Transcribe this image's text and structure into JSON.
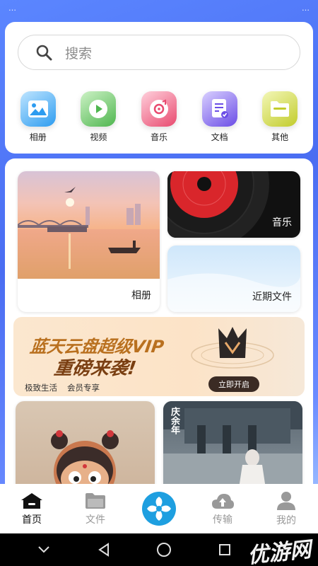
{
  "status": {
    "left": "…",
    "right": "…"
  },
  "search": {
    "placeholder": "搜索"
  },
  "categories": [
    {
      "label": "相册",
      "icon": "photo-icon",
      "color": "#36a8f4"
    },
    {
      "label": "视频",
      "icon": "play-icon",
      "color": "#58c15b"
    },
    {
      "label": "音乐",
      "icon": "music-disc-icon",
      "color": "#ef5a7c"
    },
    {
      "label": "文档",
      "icon": "document-icon",
      "color": "#7a5cf0"
    },
    {
      "label": "其他",
      "icon": "folder-icon",
      "color": "#c8d23a"
    }
  ],
  "tiles": {
    "album": "相册",
    "music": "音乐",
    "recent": "近期文件"
  },
  "vip": {
    "title": "蓝天云盘超级VIP",
    "subtitle": "重磅来袭!",
    "tag1": "极致生活",
    "tag2": "会员专享",
    "button": "立即开启"
  },
  "drama": {
    "caption": "庆余年"
  },
  "nav": [
    {
      "label": "首页",
      "icon": "home-icon",
      "active": true
    },
    {
      "label": "文件",
      "icon": "folder-icon",
      "active": false
    },
    {
      "label": "",
      "icon": "app-logo-icon",
      "active": false
    },
    {
      "label": "传输",
      "icon": "cloud-upload-icon",
      "active": false
    },
    {
      "label": "我的",
      "icon": "user-icon",
      "active": false
    }
  ],
  "watermark": "优游网",
  "colors": {
    "accent": "#1e9fe0",
    "nav_active": "#111111",
    "nav_inactive": "#999999"
  }
}
